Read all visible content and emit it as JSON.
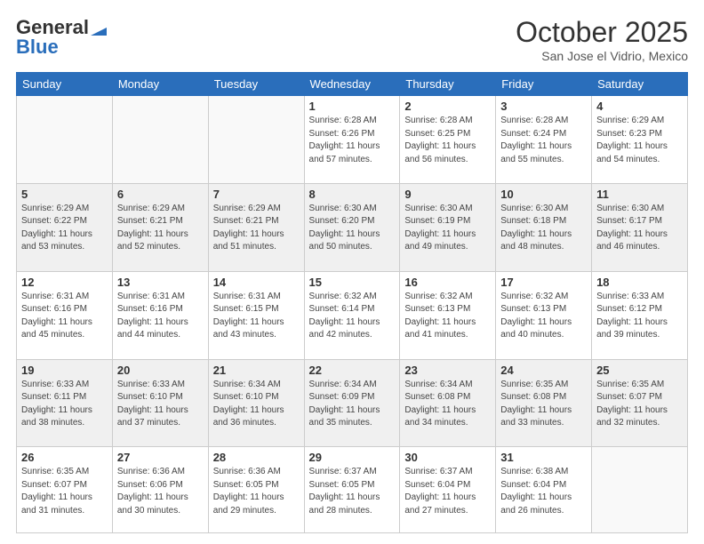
{
  "header": {
    "logo_general": "General",
    "logo_blue": "Blue",
    "month_title": "October 2025",
    "location": "San Jose el Vidrio, Mexico"
  },
  "days_of_week": [
    "Sunday",
    "Monday",
    "Tuesday",
    "Wednesday",
    "Thursday",
    "Friday",
    "Saturday"
  ],
  "weeks": [
    [
      {
        "day": "",
        "info": ""
      },
      {
        "day": "",
        "info": ""
      },
      {
        "day": "",
        "info": ""
      },
      {
        "day": "1",
        "info": "Sunrise: 6:28 AM\nSunset: 6:26 PM\nDaylight: 11 hours and 57 minutes."
      },
      {
        "day": "2",
        "info": "Sunrise: 6:28 AM\nSunset: 6:25 PM\nDaylight: 11 hours and 56 minutes."
      },
      {
        "day": "3",
        "info": "Sunrise: 6:28 AM\nSunset: 6:24 PM\nDaylight: 11 hours and 55 minutes."
      },
      {
        "day": "4",
        "info": "Sunrise: 6:29 AM\nSunset: 6:23 PM\nDaylight: 11 hours and 54 minutes."
      }
    ],
    [
      {
        "day": "5",
        "info": "Sunrise: 6:29 AM\nSunset: 6:22 PM\nDaylight: 11 hours and 53 minutes."
      },
      {
        "day": "6",
        "info": "Sunrise: 6:29 AM\nSunset: 6:21 PM\nDaylight: 11 hours and 52 minutes."
      },
      {
        "day": "7",
        "info": "Sunrise: 6:29 AM\nSunset: 6:21 PM\nDaylight: 11 hours and 51 minutes."
      },
      {
        "day": "8",
        "info": "Sunrise: 6:30 AM\nSunset: 6:20 PM\nDaylight: 11 hours and 50 minutes."
      },
      {
        "day": "9",
        "info": "Sunrise: 6:30 AM\nSunset: 6:19 PM\nDaylight: 11 hours and 49 minutes."
      },
      {
        "day": "10",
        "info": "Sunrise: 6:30 AM\nSunset: 6:18 PM\nDaylight: 11 hours and 48 minutes."
      },
      {
        "day": "11",
        "info": "Sunrise: 6:30 AM\nSunset: 6:17 PM\nDaylight: 11 hours and 46 minutes."
      }
    ],
    [
      {
        "day": "12",
        "info": "Sunrise: 6:31 AM\nSunset: 6:16 PM\nDaylight: 11 hours and 45 minutes."
      },
      {
        "day": "13",
        "info": "Sunrise: 6:31 AM\nSunset: 6:16 PM\nDaylight: 11 hours and 44 minutes."
      },
      {
        "day": "14",
        "info": "Sunrise: 6:31 AM\nSunset: 6:15 PM\nDaylight: 11 hours and 43 minutes."
      },
      {
        "day": "15",
        "info": "Sunrise: 6:32 AM\nSunset: 6:14 PM\nDaylight: 11 hours and 42 minutes."
      },
      {
        "day": "16",
        "info": "Sunrise: 6:32 AM\nSunset: 6:13 PM\nDaylight: 11 hours and 41 minutes."
      },
      {
        "day": "17",
        "info": "Sunrise: 6:32 AM\nSunset: 6:13 PM\nDaylight: 11 hours and 40 minutes."
      },
      {
        "day": "18",
        "info": "Sunrise: 6:33 AM\nSunset: 6:12 PM\nDaylight: 11 hours and 39 minutes."
      }
    ],
    [
      {
        "day": "19",
        "info": "Sunrise: 6:33 AM\nSunset: 6:11 PM\nDaylight: 11 hours and 38 minutes."
      },
      {
        "day": "20",
        "info": "Sunrise: 6:33 AM\nSunset: 6:10 PM\nDaylight: 11 hours and 37 minutes."
      },
      {
        "day": "21",
        "info": "Sunrise: 6:34 AM\nSunset: 6:10 PM\nDaylight: 11 hours and 36 minutes."
      },
      {
        "day": "22",
        "info": "Sunrise: 6:34 AM\nSunset: 6:09 PM\nDaylight: 11 hours and 35 minutes."
      },
      {
        "day": "23",
        "info": "Sunrise: 6:34 AM\nSunset: 6:08 PM\nDaylight: 11 hours and 34 minutes."
      },
      {
        "day": "24",
        "info": "Sunrise: 6:35 AM\nSunset: 6:08 PM\nDaylight: 11 hours and 33 minutes."
      },
      {
        "day": "25",
        "info": "Sunrise: 6:35 AM\nSunset: 6:07 PM\nDaylight: 11 hours and 32 minutes."
      }
    ],
    [
      {
        "day": "26",
        "info": "Sunrise: 6:35 AM\nSunset: 6:07 PM\nDaylight: 11 hours and 31 minutes."
      },
      {
        "day": "27",
        "info": "Sunrise: 6:36 AM\nSunset: 6:06 PM\nDaylight: 11 hours and 30 minutes."
      },
      {
        "day": "28",
        "info": "Sunrise: 6:36 AM\nSunset: 6:05 PM\nDaylight: 11 hours and 29 minutes."
      },
      {
        "day": "29",
        "info": "Sunrise: 6:37 AM\nSunset: 6:05 PM\nDaylight: 11 hours and 28 minutes."
      },
      {
        "day": "30",
        "info": "Sunrise: 6:37 AM\nSunset: 6:04 PM\nDaylight: 11 hours and 27 minutes."
      },
      {
        "day": "31",
        "info": "Sunrise: 6:38 AM\nSunset: 6:04 PM\nDaylight: 11 hours and 26 minutes."
      },
      {
        "day": "",
        "info": ""
      }
    ]
  ]
}
